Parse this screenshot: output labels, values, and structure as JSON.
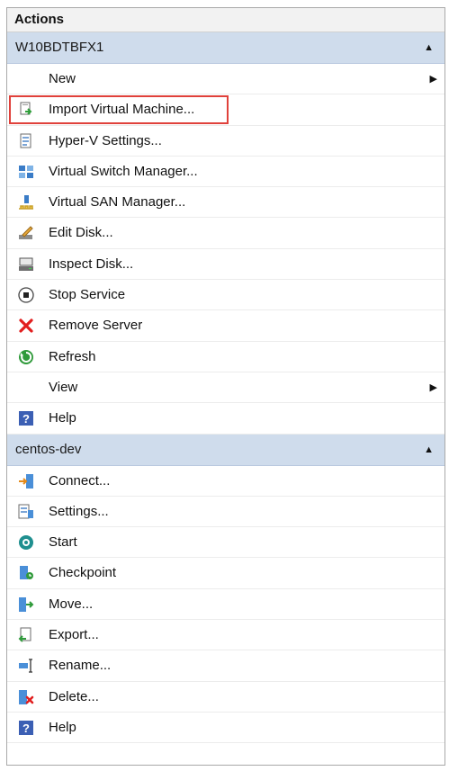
{
  "panel": {
    "title": "Actions"
  },
  "sections": [
    {
      "header": "W10BDTBFX1",
      "items": [
        {
          "label": "New",
          "icon": "none",
          "submenu": true
        },
        {
          "label": "Import Virtual Machine...",
          "icon": "import-vm-icon",
          "highlighted": true
        },
        {
          "label": "Hyper-V Settings...",
          "icon": "hyperv-settings-icon"
        },
        {
          "label": "Virtual Switch Manager...",
          "icon": "virtual-switch-icon"
        },
        {
          "label": "Virtual SAN Manager...",
          "icon": "virtual-san-icon"
        },
        {
          "label": "Edit Disk...",
          "icon": "edit-disk-icon"
        },
        {
          "label": "Inspect Disk...",
          "icon": "inspect-disk-icon"
        },
        {
          "label": "Stop Service",
          "icon": "stop-service-icon"
        },
        {
          "label": "Remove Server",
          "icon": "remove-server-icon"
        },
        {
          "label": "Refresh",
          "icon": "refresh-icon"
        },
        {
          "label": "View",
          "icon": "none",
          "submenu": true
        },
        {
          "label": "Help",
          "icon": "help-icon"
        }
      ]
    },
    {
      "header": "centos-dev",
      "items": [
        {
          "label": "Connect...",
          "icon": "connect-icon"
        },
        {
          "label": "Settings...",
          "icon": "settings-icon"
        },
        {
          "label": "Start",
          "icon": "start-icon"
        },
        {
          "label": "Checkpoint",
          "icon": "checkpoint-icon"
        },
        {
          "label": "Move...",
          "icon": "move-icon"
        },
        {
          "label": "Export...",
          "icon": "export-icon"
        },
        {
          "label": "Rename...",
          "icon": "rename-icon"
        },
        {
          "label": "Delete...",
          "icon": "delete-icon"
        },
        {
          "label": "Help",
          "icon": "help-icon"
        }
      ]
    }
  ],
  "colors": {
    "header_bg": "#cfdcec",
    "highlight": "#e0413b"
  }
}
